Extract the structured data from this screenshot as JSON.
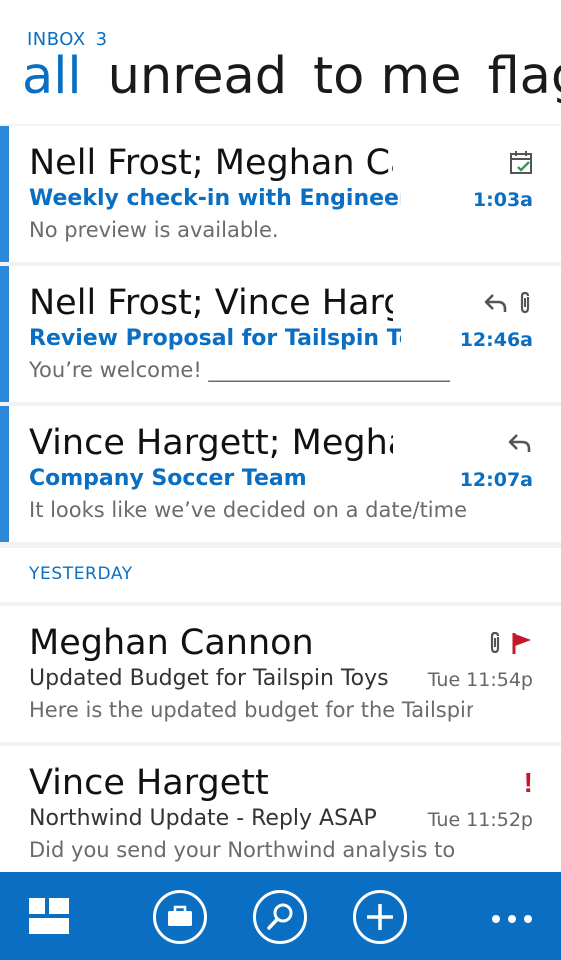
{
  "header": {
    "folder": "INBOX",
    "unread_count": "3",
    "pivots": [
      "all",
      "unread",
      "to me",
      "flagged"
    ],
    "active_pivot": "all"
  },
  "messages_today": [
    {
      "from": "Nell Frost; Meghan Cannon",
      "subject": "Weekly check-in with Engineers",
      "preview": "No preview is available.",
      "time": "1:03a",
      "unread": true,
      "icons": [
        "calendar-check-icon"
      ]
    },
    {
      "from": "Nell Frost; Vince Hargett",
      "subject": "Review Proposal for Tailspin Toys",
      "preview": "You’re welcome!  _______________________",
      "time": "12:46a",
      "unread": true,
      "icons": [
        "reply-icon",
        "attachment-icon"
      ]
    },
    {
      "from": "Vince Hargett; Meghan Cannon",
      "subject": "Company Soccer Team",
      "preview": "It looks like we’ve decided on a date/time",
      "time": "12:07a",
      "unread": true,
      "icons": [
        "reply-icon"
      ]
    }
  ],
  "group_yesterday": "YESTERDAY",
  "messages_yesterday": [
    {
      "from": "Meghan Cannon",
      "subject": "Updated Budget for Tailspin Toys",
      "preview": "Here is the updated budget for the Tailspin",
      "time": "Tue 11:54p",
      "unread": false,
      "icons": [
        "attachment-icon",
        "flag-icon"
      ]
    },
    {
      "from": "Vince Hargett",
      "subject": "Northwind Update - Reply ASAP",
      "preview": "Did you send your Northwind analysis to",
      "time": "Tue 11:52p",
      "unread": false,
      "importance": "!",
      "icons": [
        "high-importance-icon"
      ]
    }
  ],
  "appbar": {
    "buttons": [
      "select-icon",
      "folders-icon",
      "search-icon",
      "new-icon"
    ],
    "more": "•••"
  },
  "colors": {
    "accent": "#0a6fc2",
    "unread_bar": "#2b88d8",
    "flag": "#c5162b",
    "appbar": "#0a6fc2"
  }
}
